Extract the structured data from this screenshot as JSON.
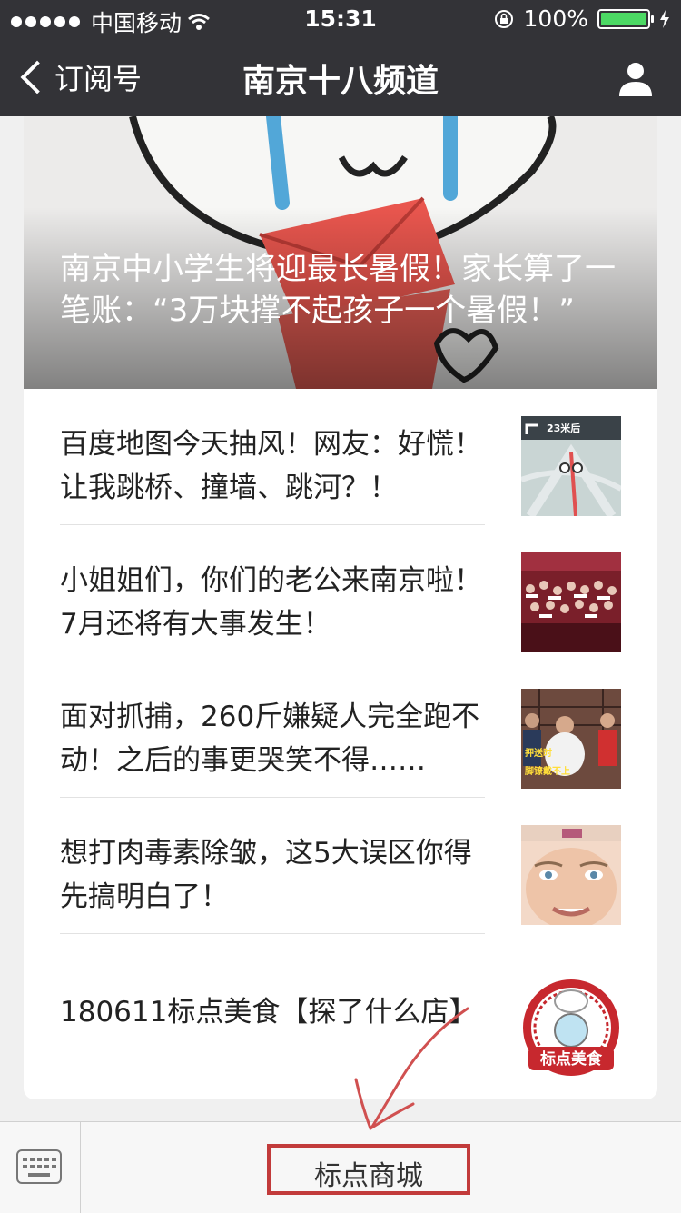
{
  "status_bar": {
    "carrier": "中国移动",
    "time": "15:31",
    "battery": "100%",
    "battery_level": 1.0
  },
  "nav": {
    "back_label": "订阅号",
    "title": "南京十八频道",
    "profile_icon": "person-icon"
  },
  "articles": {
    "hero": {
      "title": "南京中小学生将迎最长暑假！家长算了一笔账：“3万块撑不起孩子一个暑假！”"
    },
    "list": [
      {
        "title": "百度地图今天抽风！网友：好慌！让我跳桥、撞墙、跳河？！"
      },
      {
        "title": "小姐姐们，你们的老公来南京啦！7月还将有大事发生！"
      },
      {
        "title": "面对抓捕，260斤嫌疑人完全跑不动！之后的事更哭笑不得……"
      },
      {
        "title": "想打肉毒素除皱，这5大误区你得先搞明白了！"
      },
      {
        "title": "180611标点美食【探了什么店】"
      }
    ]
  },
  "thumb_text": {
    "map": "23米后",
    "arrest": "押送时",
    "arrest2": "脚镣戴不上",
    "food": "标点美食"
  },
  "bottom_bar": {
    "keyboard_icon": "keyboard-icon",
    "menu_label": "标点商城"
  },
  "colors": {
    "nav_bg": "#333337",
    "battery_green": "#4cd964",
    "highlight_red": "#c23b3b"
  }
}
